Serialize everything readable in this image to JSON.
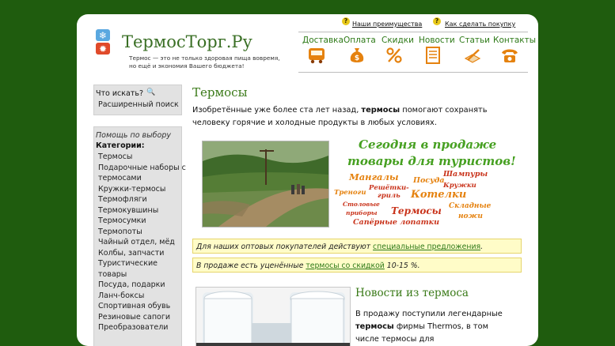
{
  "header": {
    "logo_text": "ТермосТорг.Ру",
    "tagline_line1": "Термос — это не только здоровая пища вовремя,",
    "tagline_line2": "но ещё и экономия Вашего бюджета!",
    "top_links": [
      "Наши преимущества",
      "Как сделать покупку"
    ],
    "nav": [
      {
        "label": "Доставка",
        "icon": "bus-icon"
      },
      {
        "label": "Оплата",
        "icon": "money-bag-icon"
      },
      {
        "label": "Скидки",
        "icon": "percent-icon"
      },
      {
        "label": "Новости",
        "icon": "newspaper-icon"
      },
      {
        "label": "Статьи",
        "icon": "pencil-note-icon"
      },
      {
        "label": "Контакты",
        "icon": "telephone-icon"
      }
    ]
  },
  "sidebar": {
    "search_title": "Что искать?",
    "advanced_search": "Расширенный поиск",
    "help": "Помощь по выбору",
    "categories_title": "Категории:",
    "categories": [
      "Термосы",
      "Подарочные наборы с",
      "термосами",
      "Кружки-термосы",
      "Термофляги",
      "Термокувшины",
      "Термосумки",
      "Термопоты",
      "Чайный отдел, мёд",
      "Колбы, запчасти",
      "Туристические",
      "товары",
      "Посуда, подарки",
      "Ланч-боксы",
      "Спортивная обувь",
      "Резиновые сапоги",
      "Преобразователи"
    ]
  },
  "main": {
    "title": "Термосы",
    "intro_before": "Изобретённые уже более ста лет назад, ",
    "intro_bold": "термосы",
    "intro_after": " помогают сохранять человеку горячие и холодные продукты в любых условиях.",
    "promo_line1": "Сегодня в продаже",
    "promo_line2": "товары для туристов!",
    "tags": [
      "Мангалы",
      "Посуда",
      "Шампуры",
      "Решётки-",
      "гриль",
      "Кружки",
      "Треноги",
      "Котелки",
      "Столовые",
      "приборы",
      "Термосы",
      "Складные",
      "ножи",
      "Сапёрные лопатки"
    ],
    "notice1_before": "Для наших оптовых покупателей действуют ",
    "notice1_link": "специальные предложения",
    "notice1_after": ".",
    "notice2_before": "В продаже есть уценённые ",
    "notice2_link": "термосы со скидкой",
    "notice2_after": " 10-15 %.",
    "news_title": "Новости из термоса",
    "news_before": "В продажу поступили легендарные ",
    "news_bold": "термосы",
    "news_after": " фирмы Thermos, в том числе термосы для"
  },
  "colors": {
    "background": "#1f5c0e",
    "accent": "#3a7a18",
    "tag_orange": "#e5820f",
    "tag_red": "#c9341c"
  }
}
